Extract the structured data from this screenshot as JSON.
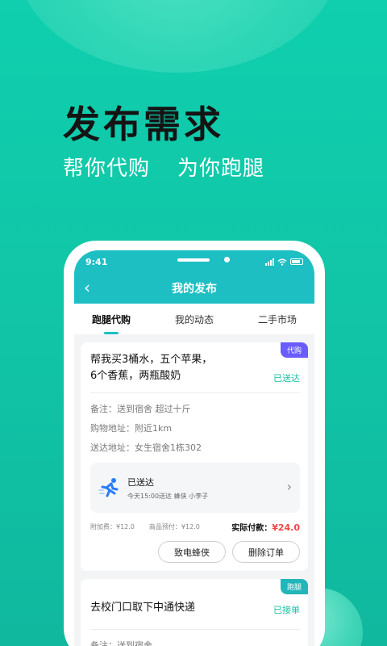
{
  "hero": {
    "headline": "发布需求",
    "sub_left": "帮你代购",
    "sub_right": "为你跑腿"
  },
  "statusbar": {
    "time": "9:41"
  },
  "appbar": {
    "back_icon": "‹",
    "title": "我的发布"
  },
  "tabs": [
    {
      "label": "跑腿代购",
      "active": true
    },
    {
      "label": "我的动态",
      "active": false
    },
    {
      "label": "二手市场",
      "active": false
    }
  ],
  "orders": [
    {
      "badge": "代购",
      "title_line1": "帮我买3桶水，五个苹果，",
      "title_line2": "6个香蕉，两瓶酸奶",
      "status": "已送达",
      "note": "备注：送到宿舍 超过十斤",
      "buy_address": "购物地址：附近1km",
      "deliver_address": "送达地址：女生宿舍1栋302",
      "delivery": {
        "title": "已送达",
        "detail": "今天15:00送达  蜂侠 小李子",
        "chevron": "›"
      },
      "fee_extra": "附加费：¥12.0",
      "fee_prepaid": "商品预付：¥12.0",
      "paid_label": "实际付款：",
      "paid_amount": "¥24.0",
      "button_call": "致电蜂侠",
      "button_delete": "删除订单"
    },
    {
      "badge": "跑腿",
      "title": "去校门口取下中通快递",
      "status": "已接单",
      "note": "备注：送到宿舍"
    }
  ],
  "colors": {
    "bg": "#11c6a7",
    "appbar": "#1dbfc3",
    "status": "#16bfa4",
    "price": "#f04747",
    "badge_buy": "#6a5cff",
    "badge_run": "#22b5b9"
  }
}
